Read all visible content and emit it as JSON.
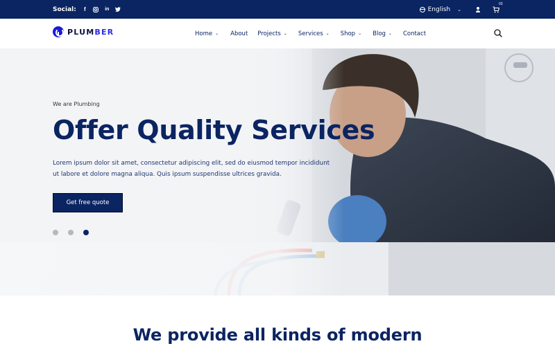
{
  "topbar": {
    "social_label": "Social:",
    "social_icons": [
      "facebook-icon",
      "instagram-icon",
      "linkedin-icon",
      "twitter-icon"
    ],
    "language": "English",
    "cart_count": "03"
  },
  "nav": {
    "logo": {
      "part1": "PLUM",
      "part2": "BER"
    },
    "items": [
      {
        "label": "Home",
        "dropdown": true
      },
      {
        "label": "About",
        "dropdown": false
      },
      {
        "label": "Projects",
        "dropdown": true
      },
      {
        "label": "Services",
        "dropdown": true
      },
      {
        "label": "Shop",
        "dropdown": true
      },
      {
        "label": "Blog",
        "dropdown": true
      },
      {
        "label": "Contact",
        "dropdown": false
      }
    ]
  },
  "hero": {
    "eyebrow": "We are Plumbing",
    "title": "Offer Quality Services",
    "description": "Lorem ipsum dolor sit amet, consectetur adipiscing elit, sed do eiusmod tempor incididunt ut labore et dolore magna aliqua. Quis ipsum suspendisse ultrices gravida.",
    "cta_label": "Get free quote",
    "slides_total": 3,
    "active_slide": 3
  },
  "section": {
    "title": "We provide all kinds of modern"
  },
  "colors": {
    "primary": "#0b2462",
    "logo_accent": "#2b2be8",
    "dot_inactive": "#b8b8b8"
  }
}
